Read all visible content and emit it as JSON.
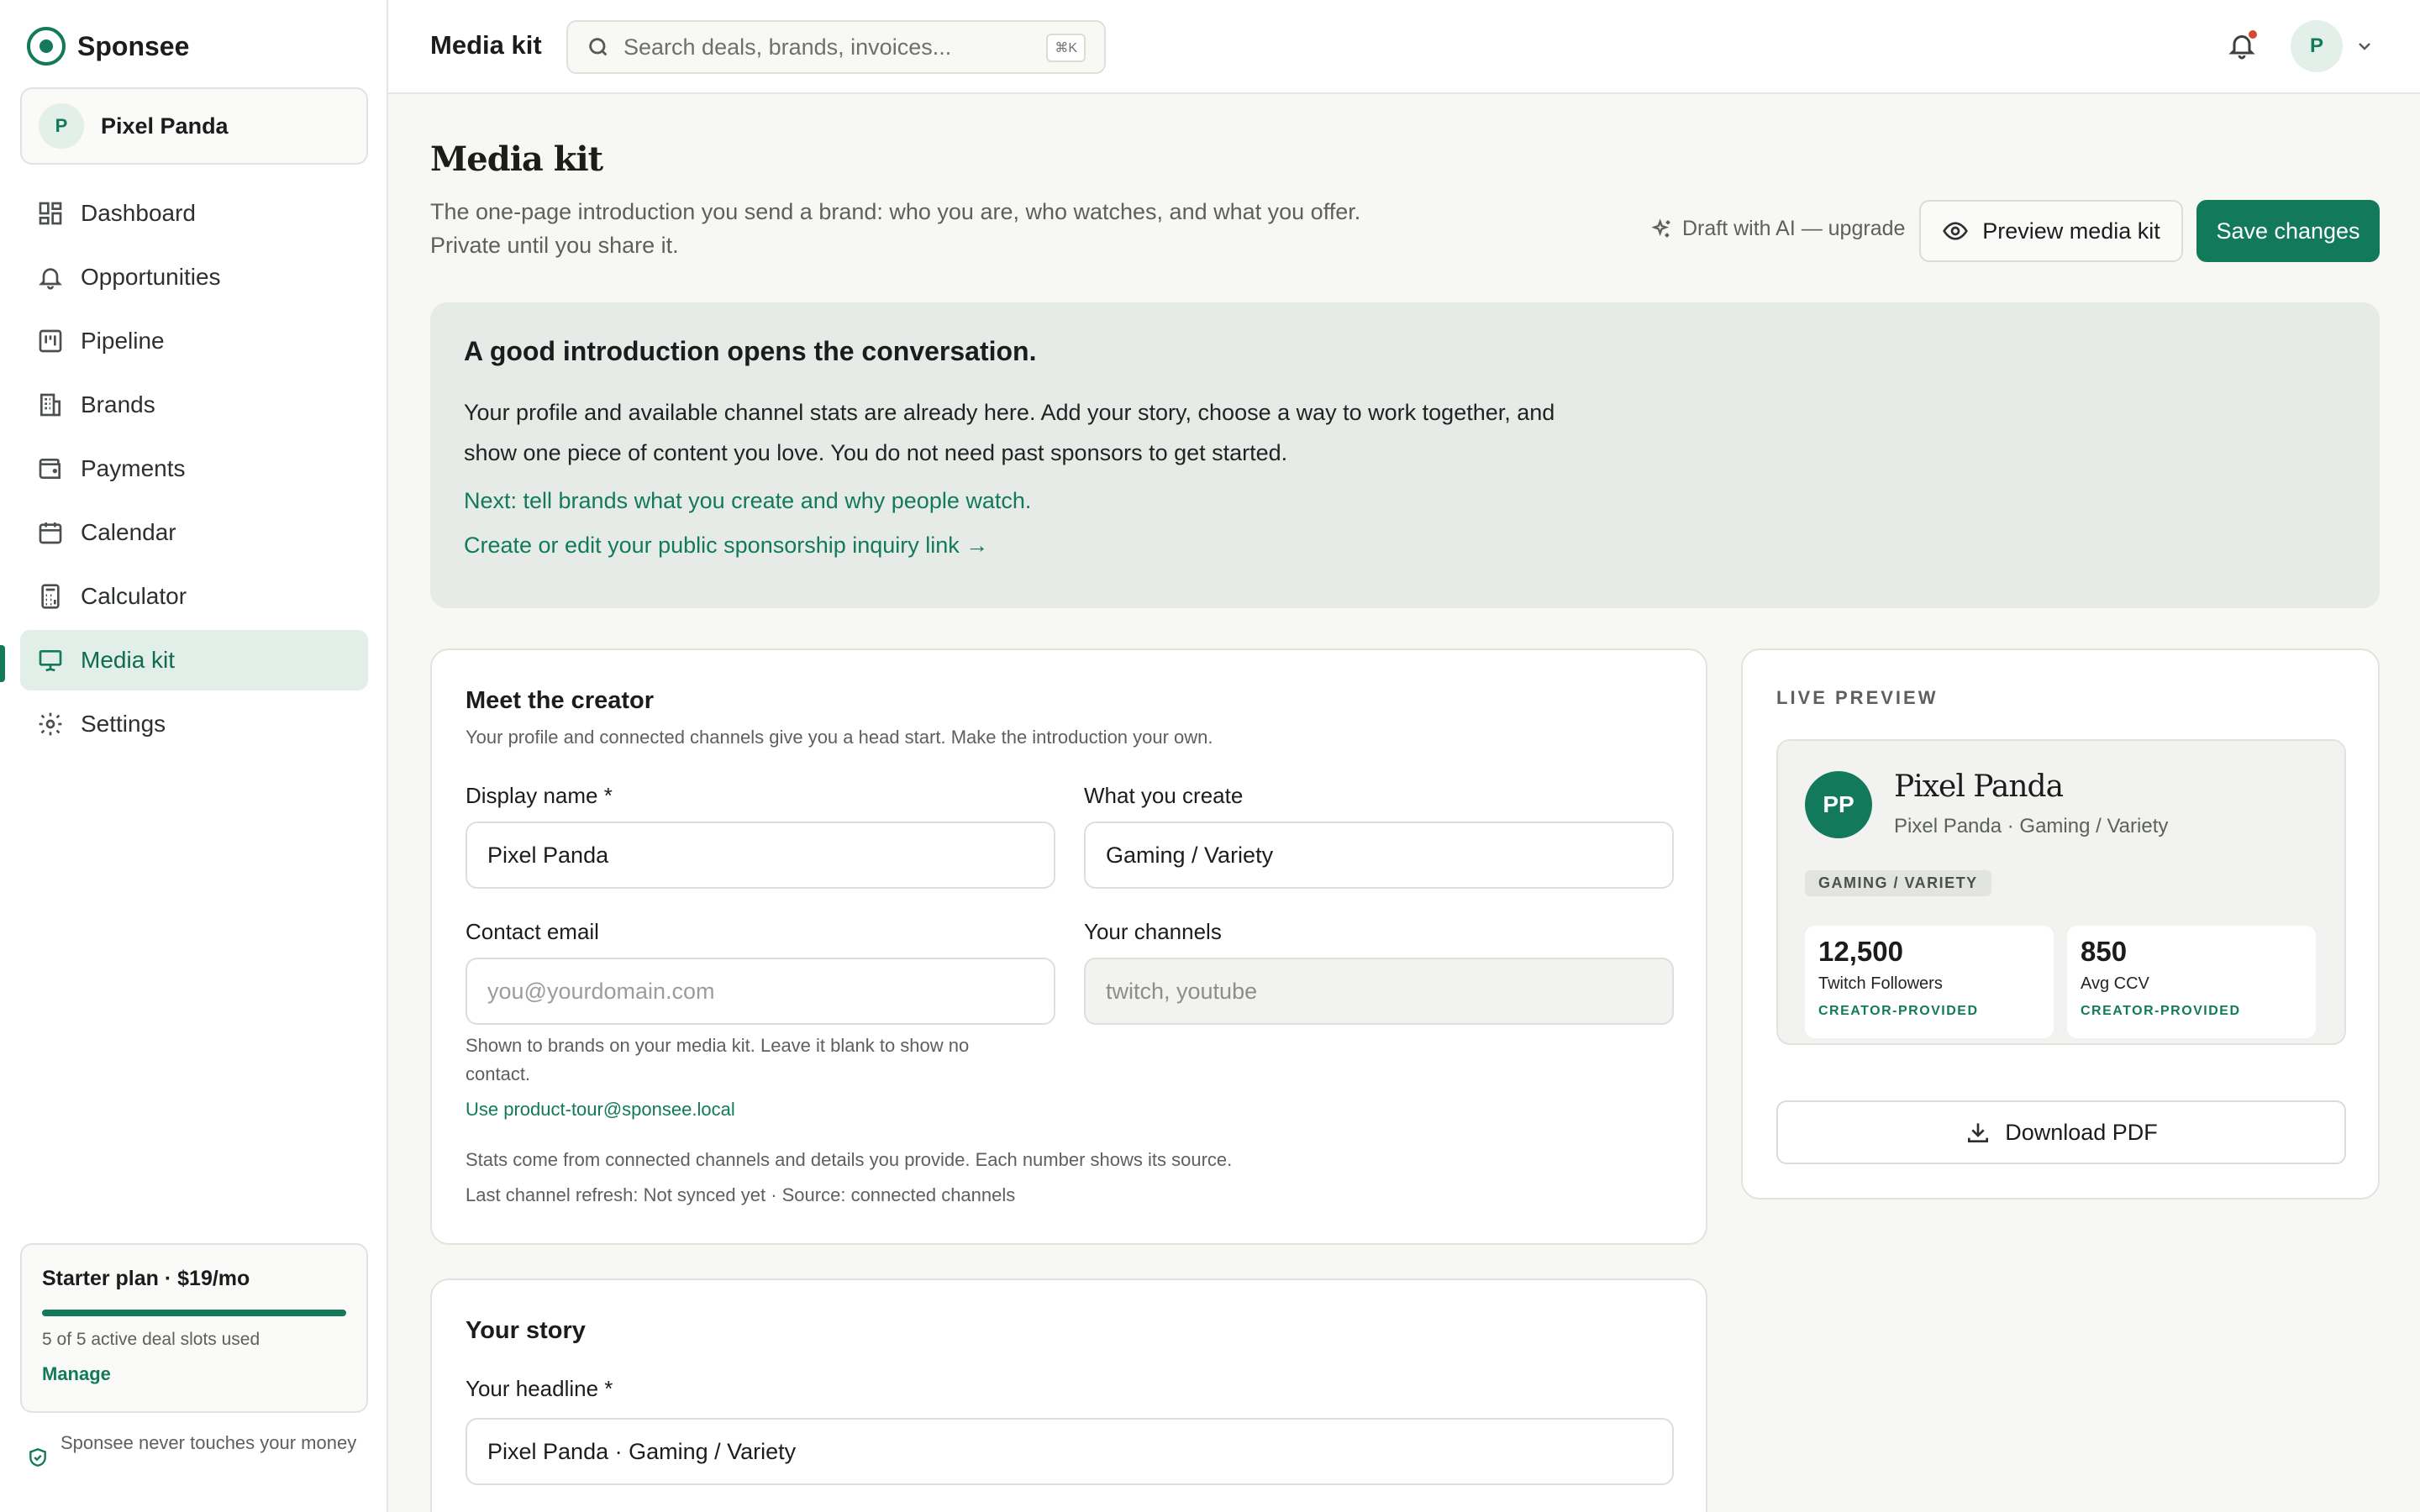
{
  "app": {
    "name": "Sponsee"
  },
  "workspace": {
    "avatar_initial": "P",
    "name": "Pixel Panda"
  },
  "sidebar": {
    "items": [
      {
        "label": "Dashboard",
        "icon": "dashboard-icon"
      },
      {
        "label": "Opportunities",
        "icon": "bell-icon"
      },
      {
        "label": "Pipeline",
        "icon": "kanban-icon"
      },
      {
        "label": "Brands",
        "icon": "building-icon"
      },
      {
        "label": "Payments",
        "icon": "wallet-icon"
      },
      {
        "label": "Calendar",
        "icon": "calendar-icon"
      },
      {
        "label": "Calculator",
        "icon": "calculator-icon"
      },
      {
        "label": "Media kit",
        "icon": "presentation-icon",
        "active": true
      },
      {
        "label": "Settings",
        "icon": "gear-icon"
      }
    ],
    "plan": {
      "title": "Starter plan · $19/mo",
      "usage_text": "5 of 5 active deal slots used",
      "usage_fraction": 1.0,
      "manage_label": "Manage"
    },
    "trust_note": "Sponsee never touches your money"
  },
  "topbar": {
    "title": "Media kit",
    "search_placeholder": "Search deals, brands, invoices...",
    "search_shortcut": "⌘K",
    "user_initial": "P"
  },
  "page": {
    "title": "Media kit",
    "subtitle_line1": "The one-page introduction you send a brand: who you are, who watches, and what you offer.",
    "subtitle_line2": "Private until you share it.",
    "ai_draft_label": "Draft with AI — upgrade",
    "preview_button": "Preview media kit",
    "save_button": "Save changes"
  },
  "banner": {
    "heading": "A good introduction opens the conversation.",
    "body": "Your profile and available channel stats are already here. Add your story, choose a way to work together, and show one piece of content you love. You do not need past sponsors to get started.",
    "next": "Next: tell brands what you create and why people watch.",
    "link": "Create or edit your public sponsorship inquiry link →"
  },
  "creator": {
    "title": "Meet the creator",
    "subtitle": "Your profile and connected channels give you a head start. Make the introduction your own.",
    "display_name_label": "Display name *",
    "display_name_value": "Pixel Panda",
    "create_label": "What you create",
    "create_value": "Gaming / Variety",
    "email_label": "Contact email",
    "email_placeholder": "you@yourdomain.com",
    "channels_label": "Your channels",
    "channels_placeholder": "twitch, youtube",
    "email_help_line1": "Shown to brands on your media kit. Leave it blank to show no",
    "email_help_line2": "contact.",
    "email_suggestion": "Use product-tour@sponsee.local",
    "stats_note": "Stats come from connected channels and details you provide. Each number shows its source.",
    "refresh_note": "Last channel refresh: Not synced yet · Source: connected channels"
  },
  "story": {
    "title": "Your story",
    "headline_label": "Your headline *",
    "headline_value": "Pixel Panda · Gaming / Variety"
  },
  "preview": {
    "label": "LIVE PREVIEW",
    "avatar_initials": "PP",
    "name": "Pixel Panda",
    "meta": "Pixel Panda · Gaming / Variety",
    "tag": "GAMING / VARIETY",
    "stats": [
      {
        "value": "12,500",
        "label": "Twitch Followers",
        "source": "CREATOR-PROVIDED"
      },
      {
        "value": "850",
        "label": "Avg CCV",
        "source": "CREATOR-PROVIDED"
      }
    ],
    "download_label": "Download PDF"
  },
  "colors": {
    "accent": "#127a5b",
    "accent_soft": "#e1efe8",
    "banner_bg": "#e6ebe8",
    "notification_dot": "#d04a30"
  }
}
